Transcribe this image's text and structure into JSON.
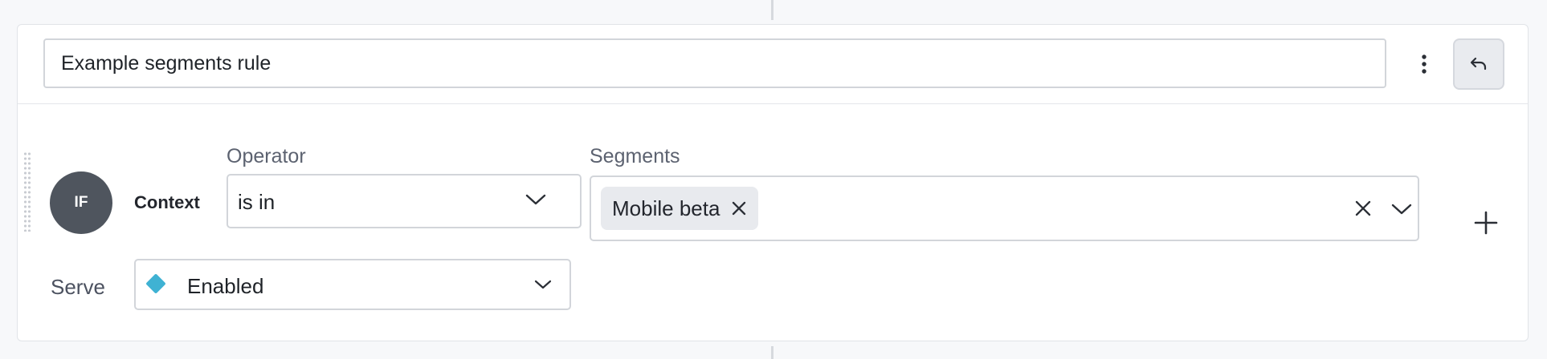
{
  "rule": {
    "name_value": "Example segments rule",
    "name_placeholder": "",
    "more_options_icon": "kebab-vertical-icon",
    "undo_icon": "undo-icon"
  },
  "clause": {
    "badge_text": "IF",
    "attribute_label": "Context",
    "operator": {
      "label": "Operator",
      "value": "is in"
    },
    "segments": {
      "label": "Segments",
      "selected": [
        "Mobile beta"
      ]
    },
    "add_icon": "plus-icon"
  },
  "serve": {
    "label": "Serve",
    "value": "Enabled",
    "variation_color": "#3fb2d3"
  },
  "colors": {
    "badge_bg": "#4f555e",
    "tag_bg": "#e8eaee",
    "undo_bg": "#e9ebef"
  }
}
